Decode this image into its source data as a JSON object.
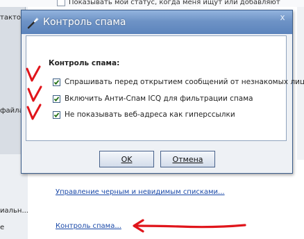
{
  "background": {
    "top_option": "Показывать мой статус, когда меня ищут или добавляют",
    "left_fragments": [
      "такто",
      "файла",
      "иальн...",
      "е"
    ],
    "links": [
      "Управление черным и невидимым списками...",
      "Контроль спама..."
    ]
  },
  "dialog": {
    "title": "Контроль спама",
    "close_glyph": "x",
    "section_label": "Контроль спама:",
    "options": [
      {
        "label": "Спрашивать перед открытием сообщений от незнакомых лиц",
        "checked": true
      },
      {
        "label": "Включить Анти-Спам ICQ для фильтрации спама",
        "checked": true
      },
      {
        "label": "Не показывать веб-адреса как гиперссылки",
        "checked": true
      }
    ],
    "ok_label": "OK",
    "cancel_label": "Отмена"
  },
  "colors": {
    "title_bar": "#6e93c6",
    "annotation_red": "#e0151b",
    "link_blue": "#1a49a8"
  },
  "icons": {
    "title": "wand-icon",
    "close": "close-icon",
    "check": "checkmark-icon"
  }
}
